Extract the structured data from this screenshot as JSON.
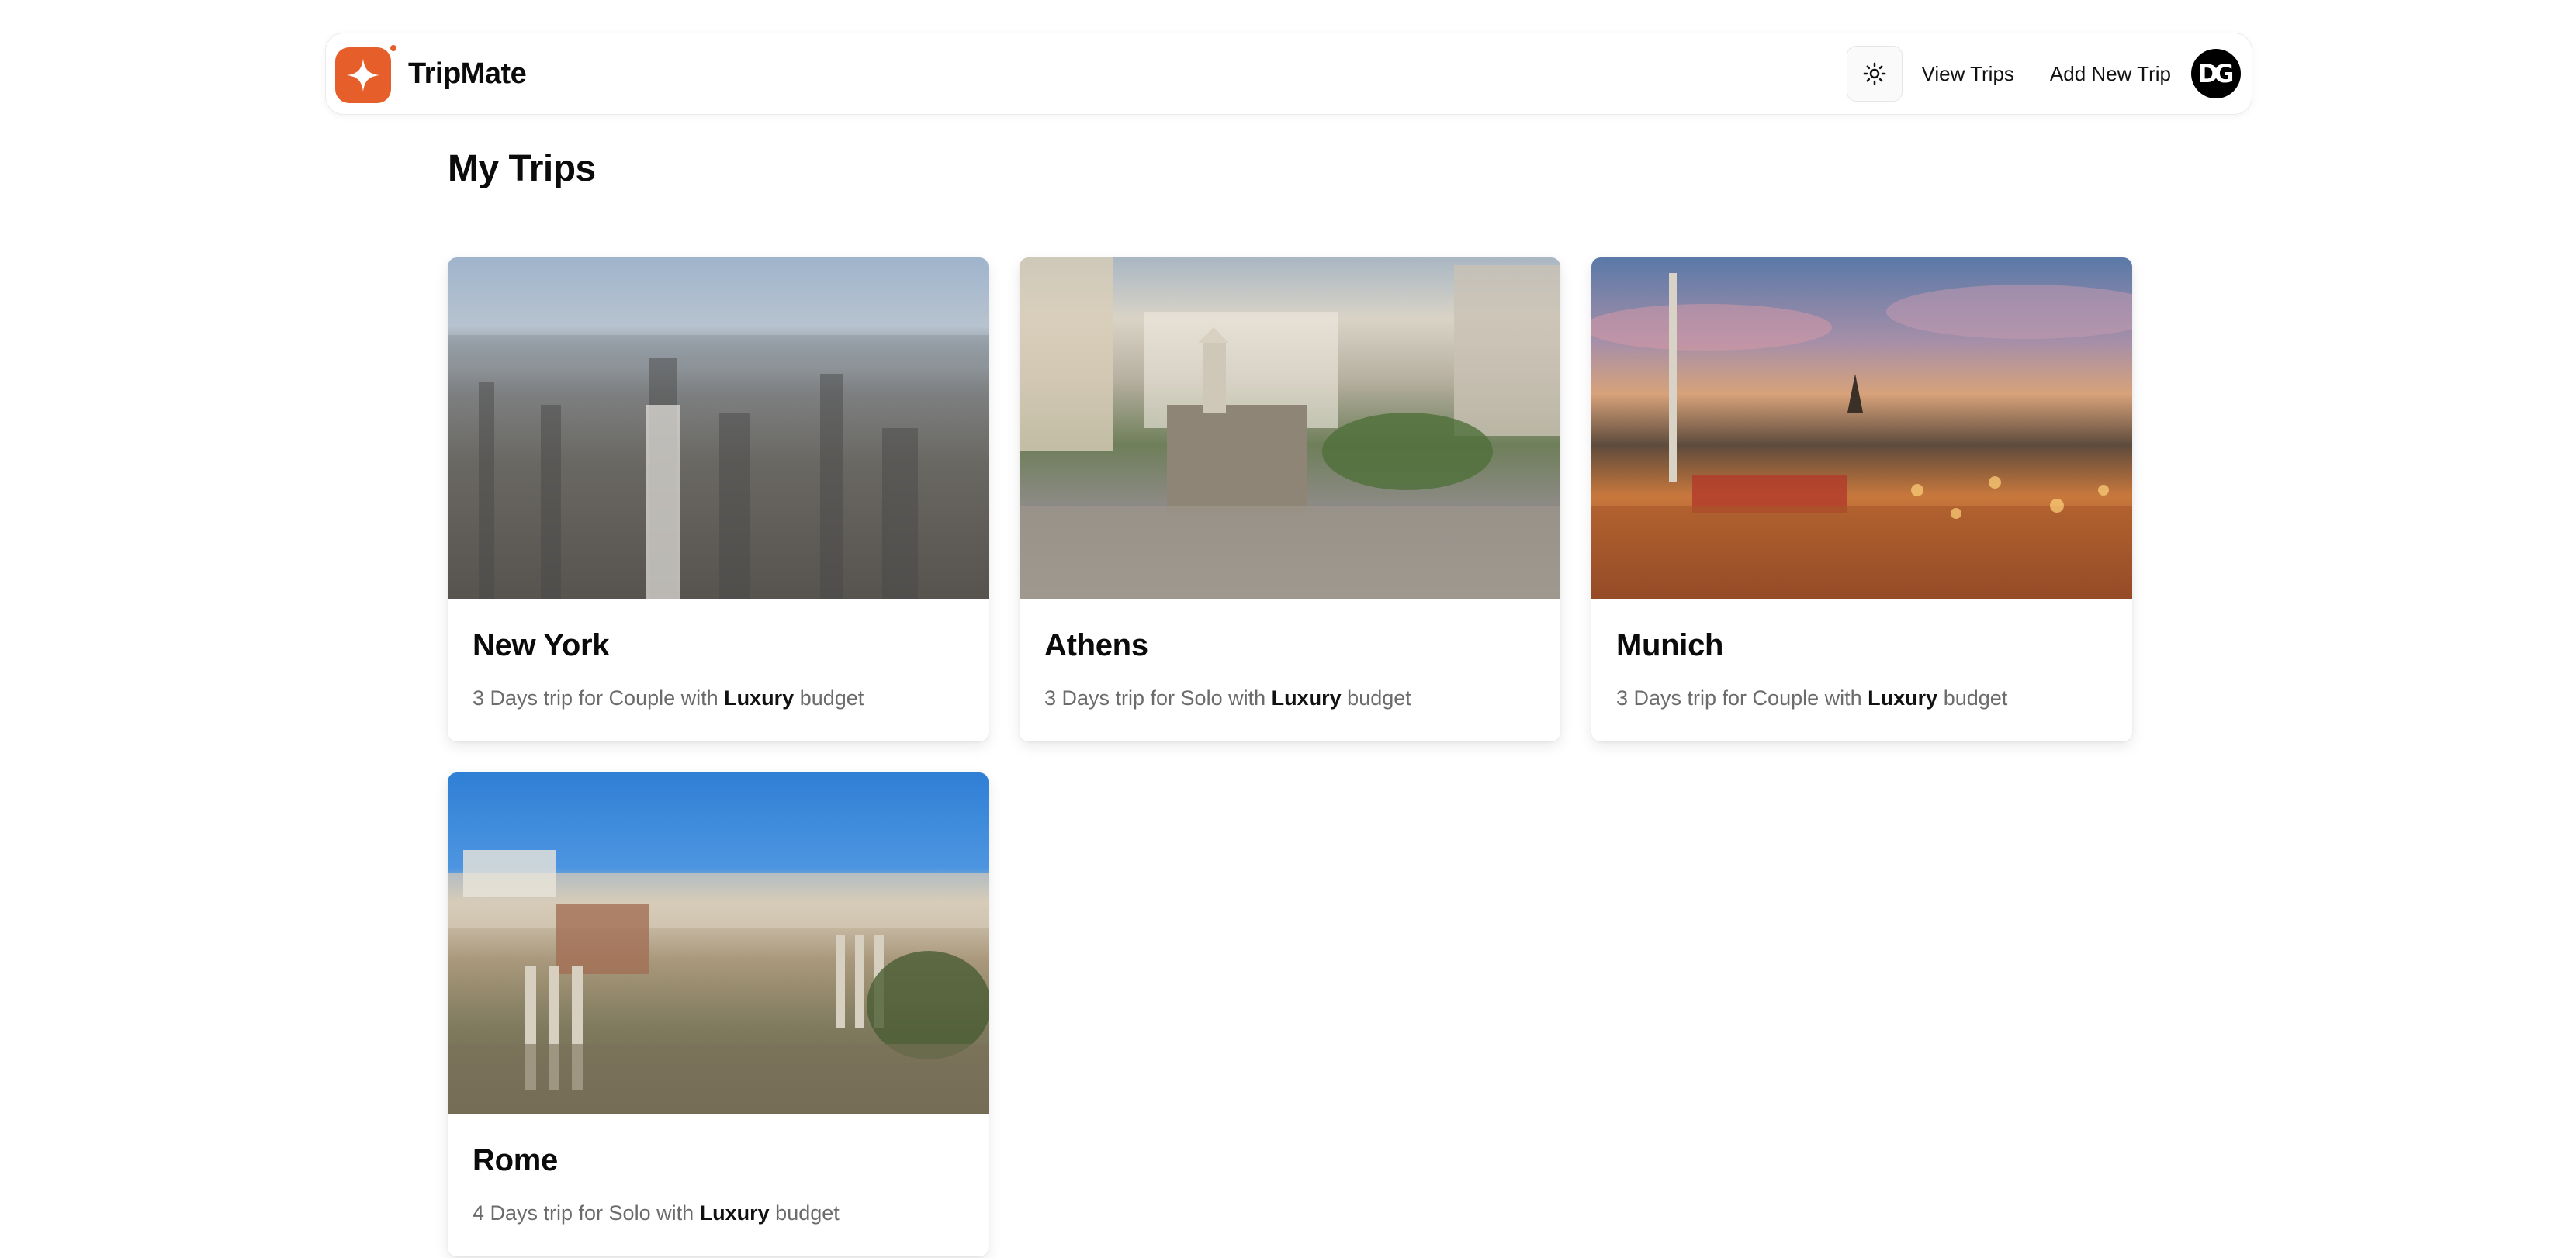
{
  "header": {
    "brand": "TripMate",
    "nav": {
      "view_trips": "View Trips",
      "add_new_trip": "Add New Trip"
    },
    "avatar_initials": "DG",
    "theme_icon": "sun-icon",
    "accent_color": "#e65f2b"
  },
  "main": {
    "title": "My Trips",
    "trips": [
      {
        "city": "New York",
        "desc_prefix": "3 Days trip for Couple with",
        "budget": "Luxury",
        "desc_suffix": "budget"
      },
      {
        "city": "Athens",
        "desc_prefix": "3 Days trip for Solo with",
        "budget": "Luxury",
        "desc_suffix": "budget"
      },
      {
        "city": "Munich",
        "desc_prefix": "3 Days trip for Couple with",
        "budget": "Luxury",
        "desc_suffix": "budget"
      },
      {
        "city": "Rome",
        "desc_prefix": "4 Days trip for Solo with",
        "budget": "Luxury",
        "desc_suffix": "budget"
      }
    ]
  }
}
